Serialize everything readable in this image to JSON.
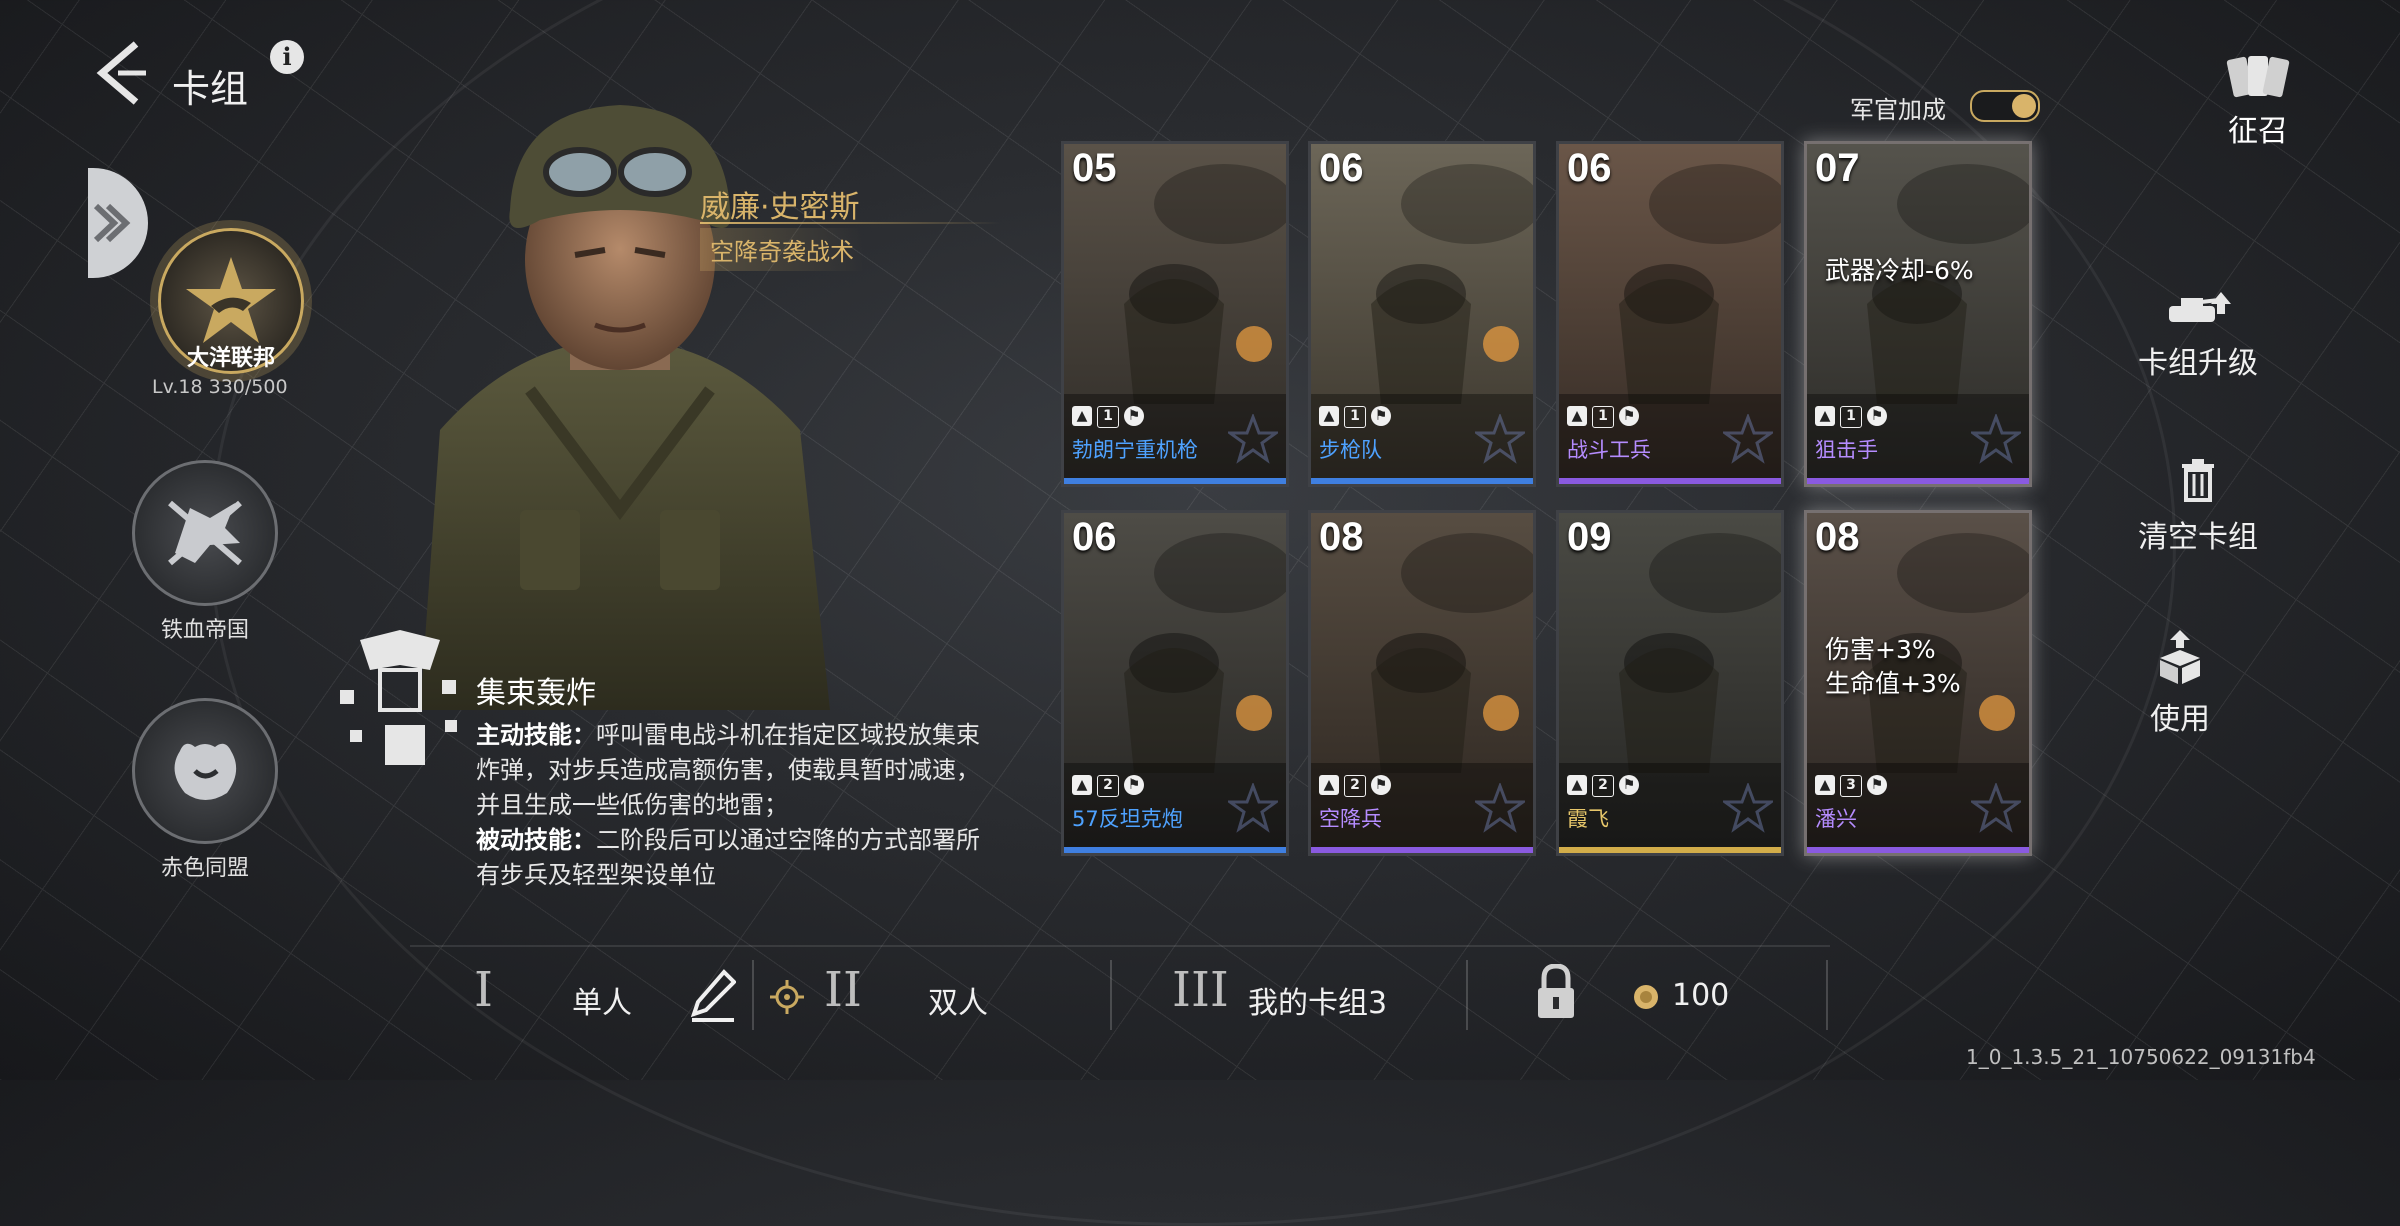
{
  "header": {
    "title": "卡组",
    "back_icon": "back-chevron-icon",
    "info_icon": "info-icon"
  },
  "factions": [
    {
      "name": "大洋联邦",
      "level_text": "Lv.18  330/500",
      "selected": true
    },
    {
      "name": "铁血帝国",
      "selected": false
    },
    {
      "name": "赤色同盟",
      "selected": false
    }
  ],
  "commander": {
    "name": "威廉·史密斯",
    "tactic": "空降奇袭战术",
    "skill": {
      "name": "集束轰炸",
      "active_label": "主动技能：",
      "active_text": "呼叫雷电战斗机在指定区域投放集束炸弹，对步兵造成高额伤害，使载具暂时减速，并且生成一些低伤害的地雷；",
      "passive_label": "被动技能：",
      "passive_text": "二阶段后可以通过空降的方式部署所有步兵及轻型架设单位"
    }
  },
  "officer_bonus": {
    "label": "军官加成",
    "on": true
  },
  "cards": [
    {
      "cost": "05",
      "name": "勃朗宁重机枪",
      "count": "1",
      "color": "#4ea2ff",
      "bar": "#3f7fe0",
      "bonus": ""
    },
    {
      "cost": "06",
      "name": "步枪队",
      "count": "1",
      "color": "#4ea2ff",
      "bar": "#3f7fe0",
      "bonus": ""
    },
    {
      "cost": "06",
      "name": "战斗工兵",
      "count": "1",
      "color": "#b58cff",
      "bar": "#8a5ae0",
      "bonus": ""
    },
    {
      "cost": "07",
      "name": "狙击手",
      "count": "1",
      "color": "#b58cff",
      "bar": "#8a5ae0",
      "bonus": "武器冷却-6%"
    },
    {
      "cost": "06",
      "name": "57反坦克炮",
      "count": "2",
      "color": "#4ea2ff",
      "bar": "#3f7fe0",
      "bonus": ""
    },
    {
      "cost": "08",
      "name": "空降兵",
      "count": "2",
      "color": "#b58cff",
      "bar": "#8a5ae0",
      "bonus": ""
    },
    {
      "cost": "09",
      "name": "霞飞",
      "count": "2",
      "color": "#e6c66a",
      "bar": "#d2ad4a",
      "bonus": ""
    },
    {
      "cost": "08",
      "name": "潘兴",
      "count": "3",
      "color": "#b58cff",
      "bar": "#8a5ae0",
      "bonus": "伤害+3%\n生命值+3%"
    }
  ],
  "right_panel": {
    "recruit": "征召",
    "upgrade": "卡组升级",
    "clear": "清空卡组",
    "use": "使用"
  },
  "bottom_bar": {
    "slot1_num": "I",
    "slot1_label": "单人",
    "slot2_num": "II",
    "slot2_label": "双人",
    "slot3_num": "III",
    "slot3_label": "我的卡组3",
    "currency": "100"
  },
  "version": "1_0_1.3.5_21_10750622_09131fb4",
  "colors": {
    "gold": "#d9b46a",
    "blue": "#3f7fe0",
    "purple": "#8a5ae0"
  }
}
